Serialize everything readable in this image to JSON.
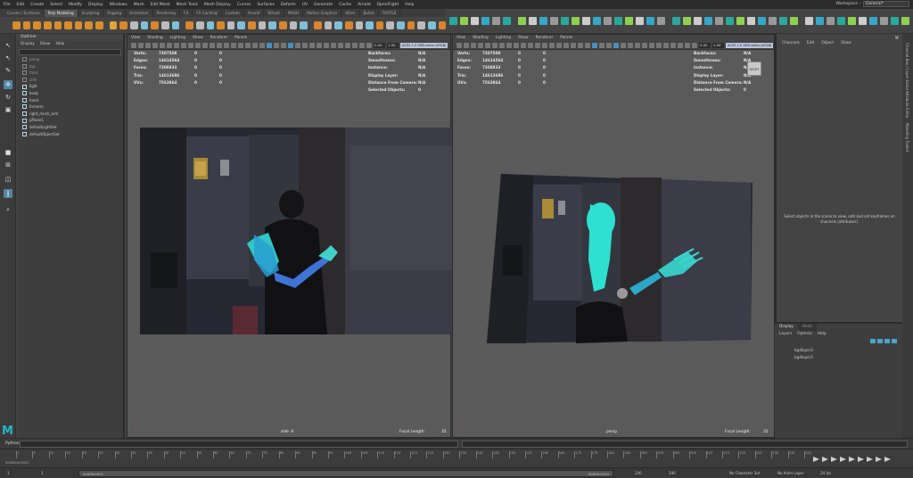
{
  "menubar": {
    "items": [
      "File",
      "Edit",
      "Create",
      "Select",
      "Modify",
      "Display",
      "Windows",
      "Mesh",
      "Edit Mesh",
      "Mesh Tools",
      "Mesh Display",
      "Curves",
      "Surfaces",
      "Deform",
      "UV",
      "Generate",
      "Cache",
      "Arnold",
      "OpenFlight",
      "Help"
    ],
    "workspace_label": "Workspace :",
    "workspace_value": "General*"
  },
  "shelf": {
    "tabs": [
      "Curves / Surfaces",
      "Poly Modeling",
      "Sculpting",
      "Rigging",
      "Animation",
      "Rendering",
      "FX",
      "FX Caching",
      "Custom",
      "Arnold",
      "Bifrost",
      "MASH",
      "Motion Graphics",
      "XGen",
      "Bullet",
      "TURTLE"
    ],
    "active_tab": "Poly Modeling"
  },
  "outliner": {
    "title": "Outliner",
    "menu": [
      "Display",
      "Show",
      "Help"
    ],
    "items": [
      {
        "label": "persp",
        "visible": false
      },
      {
        "label": "top",
        "visible": false
      },
      {
        "label": "front",
        "visible": false
      },
      {
        "label": "side",
        "visible": false
      },
      {
        "label": "light",
        "visible": true
      },
      {
        "label": "body",
        "visible": true
      },
      {
        "label": "hand",
        "visible": true
      },
      {
        "label": "forearm",
        "visible": true
      },
      {
        "label": "right_mesh_arm",
        "visible": true
      },
      {
        "label": "pPlane1",
        "visible": true
      },
      {
        "label": "defaultLightSet",
        "visible": true
      },
      {
        "label": "defaultObjectSet",
        "visible": true
      }
    ]
  },
  "viewports": [
    {
      "menu": [
        "View",
        "Shading",
        "Lighting",
        "Show",
        "Renderer",
        "Panels"
      ],
      "num1": "0.00",
      "num2": "1.00",
      "colorspace": "ACES 1.0 SDR-video (sRGB)",
      "hud_left": [
        [
          "Verts:",
          "7307508",
          "0",
          "0"
        ],
        [
          "Edges:",
          "14614564",
          "0",
          "0"
        ],
        [
          "Faces:",
          "7308833",
          "0",
          "0"
        ],
        [
          "Tris:",
          "14613686",
          "0",
          "0"
        ],
        [
          "UVs:",
          "7563864",
          "0",
          "0"
        ]
      ],
      "hud_right": [
        [
          "Backfaces:",
          "N/A"
        ],
        [
          "Smoothness:",
          "N/A"
        ],
        [
          "Instance:",
          "N/A"
        ],
        [
          "Display Layer:",
          "N/A"
        ],
        [
          "Distance From Camera:",
          "N/A"
        ],
        [
          "Selected Objects:",
          "0"
        ]
      ],
      "camera": "side -X",
      "focal_label": "Focal Length:",
      "focal_value": "35"
    },
    {
      "menu": [
        "View",
        "Shading",
        "Lighting",
        "Show",
        "Renderer",
        "Panels"
      ],
      "num1": "0.00",
      "num2": "1.00",
      "colorspace": "ACES 1.0 SDR-video (sRGB)",
      "hud_left": [
        [
          "Verts:",
          "7307508",
          "0",
          "0"
        ],
        [
          "Edges:",
          "14614564",
          "0",
          "0"
        ],
        [
          "Faces:",
          "7308833",
          "0",
          "0"
        ],
        [
          "Tris:",
          "14613686",
          "0",
          "0"
        ],
        [
          "UVs:",
          "7563864",
          "0",
          "0"
        ]
      ],
      "hud_right": [
        [
          "Backfaces:",
          "N/A"
        ],
        [
          "Smoothness:",
          "N/A"
        ],
        [
          "Instance:",
          "N/A"
        ],
        [
          "Display Layer:",
          "N/A"
        ],
        [
          "Distance From Camera:",
          "N/A"
        ],
        [
          "Selected Objects:",
          "0"
        ]
      ],
      "camera": "persp",
      "focal_label": "Focal Length:",
      "focal_value": "35",
      "viewcube": "RIGHT"
    }
  ],
  "channelbox": {
    "menu": [
      "Channels",
      "Edit",
      "Object",
      "Show"
    ],
    "message": "Select objects in the scene to view, edit and set keyframes on channels (attributes)."
  },
  "sidetabs": [
    "Channel Box / Layer Editor",
    "Attribute Editor",
    "Modeling Toolkit"
  ],
  "layers": {
    "tabs": [
      "Display",
      "Anim"
    ],
    "menu": [
      "Layers",
      "Options",
      "Help"
    ],
    "rows": [
      {
        "label": "bgdlayer2"
      },
      {
        "label": "bgdlayer1"
      }
    ]
  },
  "cmdline": {
    "lang": "Python"
  },
  "timeline": {
    "start_field": "0000000:0001",
    "ticks": [
      "1",
      "5",
      "10",
      "15",
      "20",
      "25",
      "30",
      "35",
      "40",
      "45",
      "50",
      "55",
      "60",
      "65",
      "70",
      "75",
      "80",
      "85",
      "90",
      "95",
      "100",
      "105",
      "110",
      "115",
      "120",
      "125",
      "130",
      "135",
      "140",
      "145",
      "150",
      "155",
      "160",
      "165",
      "170",
      "175",
      "180",
      "185",
      "190",
      "195",
      "200",
      "205",
      "210",
      "215",
      "220",
      "225",
      "230",
      "235",
      "240"
    ]
  },
  "rangebar": {
    "start": "1",
    "start2": "1",
    "range_start": "00000:0001",
    "range_end": "00000:0240",
    "end1": "240",
    "end2": "240",
    "character_set": "No Character Set",
    "anim_layer": "No Anim Layer",
    "fps": "24 fps"
  }
}
